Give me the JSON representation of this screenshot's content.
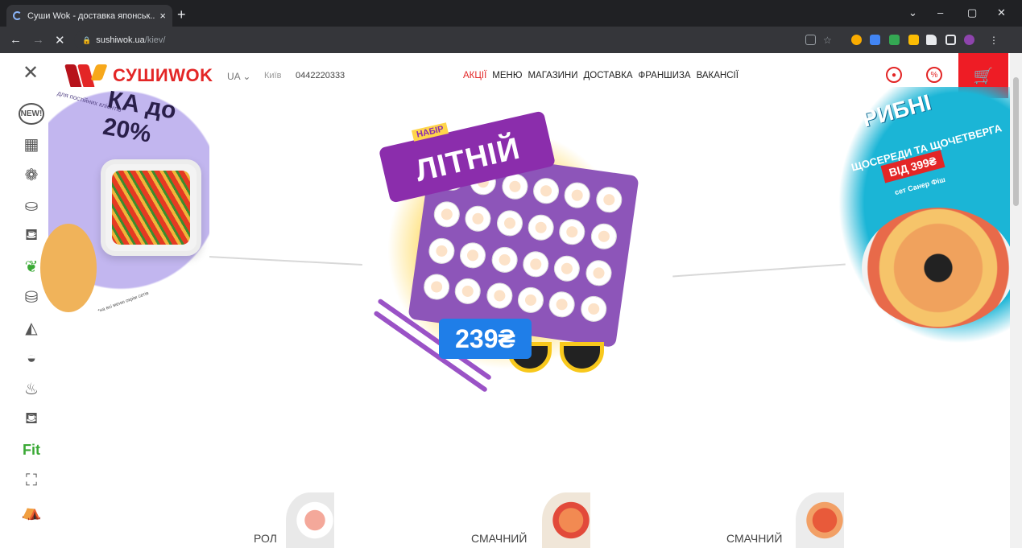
{
  "browser": {
    "tab_title": "Суши Wok - доставка японськ...",
    "tab_close": "×",
    "new_tab": "+",
    "url_host": "sushiwok.ua",
    "url_path": "/kiev/",
    "controls": {
      "minimize": "–",
      "maximize": "▢",
      "close": "✕",
      "back": "←",
      "forward": "→",
      "stop": "✕"
    }
  },
  "header": {
    "logo_text": "СУШИWOK",
    "lang": "UA",
    "city": "Київ",
    "phone": "0442220333",
    "nav": [
      "АКЦІЇ",
      "МЕНЮ",
      "МАГАЗИНИ",
      "ДОСТАВКА",
      "ФРАНШИЗА",
      "ВАКАНСІЇ"
    ],
    "active_nav": "АКЦІЇ",
    "brand_color": "#e32626",
    "cart_color": "#ee1c25"
  },
  "sidebar": {
    "items": [
      "new-icon",
      "set-icon",
      "rolls-icon",
      "sushi-icon",
      "wok-icon",
      "vegan-icon",
      "maki-icon",
      "pizza-icon",
      "bowl-icon",
      "soup-icon",
      "drinks-icon",
      "fit",
      "snack-icon",
      "basket-icon"
    ],
    "new_label": "NEW!",
    "fit_label": "Fit"
  },
  "banners": {
    "left": {
      "headline": "КА до 20%",
      "sub": "для постійних клієнтів*",
      "note": "*на всі меню окрім сетів"
    },
    "center": {
      "set_label": "НАБІР",
      "name": "ЛІТНІЙ",
      "price": "239₴"
    },
    "right": {
      "headline": "РИБНІ",
      "sub": "ЩОСЕРЕДИ ТА ЩОЧЕТВЕРГА",
      "price_tag": "ВІД 399₴",
      "set_name": "сет Санер Фіш"
    }
  },
  "categories": [
    "РОЛ",
    "СМАЧНИЙ",
    "СМАЧНИЙ"
  ]
}
